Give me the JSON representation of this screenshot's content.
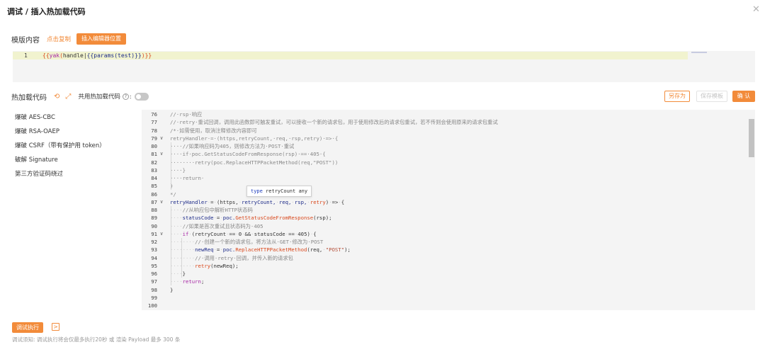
{
  "window": {
    "title": "调试 / 插入热加载代码",
    "close_icon": "close-icon"
  },
  "template_section": {
    "label": "模版内容",
    "copy_link": "点击复制",
    "insert_button": "插入编辑器位置",
    "line_number": "1",
    "code": {
      "open": "{{",
      "fn": "yak",
      "paren_open": "(",
      "arg": "handle",
      "pipe": "|",
      "inner_open": "{{",
      "inner_fn": "params",
      "inner_arg_open": "(",
      "inner_arg": "test",
      "inner_close": ")}}",
      "close": ")}}"
    }
  },
  "hotload_section": {
    "label": "热加载代码",
    "refresh_icon": "refresh-icon",
    "expand_icon": "expand-icon",
    "shared_label": "共用热加载代码",
    "help_icon": "?",
    "shared_enabled": false,
    "save_as": "另存为",
    "save_template": "保存模板",
    "confirm": "确 认"
  },
  "sidebar": {
    "items": [
      "爆破 AES-CBC",
      "爆破 RSA-OAEP",
      "爆破 CSRF（带有保护用 token）",
      "破解 Signature",
      "第三方验证码绕过"
    ]
  },
  "code_editor": {
    "tooltip": {
      "kw": "type",
      "name": "retryCount",
      "type": "any"
    },
    "lines": [
      {
        "n": "76",
        "fold": "",
        "segs": [
          [
            "c-com",
            "//·rsp·响应"
          ]
        ]
      },
      {
        "n": "77",
        "fold": "",
        "segs": [
          [
            "c-com",
            "//·retry·重试回调，调用此函数即可触发重试，可以接收一个新的请求包，用于使用修改后的请求包重试，若不传则会使用原来的请求包重试"
          ]
        ]
      },
      {
        "n": "78",
        "fold": "",
        "segs": [
          [
            "c-com",
            "/*·如需使用，取消注释修改内容即可"
          ]
        ]
      },
      {
        "n": "79",
        "fold": "∨",
        "segs": [
          [
            "c-com",
            "retryHandler·=·(https,retryCount,·req,·rsp,retry)·=>·{"
          ]
        ]
      },
      {
        "n": "80",
        "fold": "",
        "segs": [
          [
            "c-com",
            "····//如果响应码为405，则修改方法为·POST·重试"
          ]
        ]
      },
      {
        "n": "81",
        "fold": "∨",
        "segs": [
          [
            "c-com",
            "····if·poc.GetStatusCodeFromResponse(rsp)·==·405·{"
          ]
        ]
      },
      {
        "n": "82",
        "fold": "",
        "segs": [
          [
            "c-com",
            "········retry(poc.ReplaceHTTPPacketMethod(req,\"POST\"))"
          ]
        ]
      },
      {
        "n": "83",
        "fold": "",
        "segs": [
          [
            "c-com",
            "····}"
          ]
        ]
      },
      {
        "n": "84",
        "fold": "",
        "segs": [
          [
            "c-com",
            "····return·"
          ]
        ]
      },
      {
        "n": "85",
        "fold": "",
        "segs": [
          [
            "c-com",
            "}"
          ]
        ]
      },
      {
        "n": "86",
        "fold": "",
        "segs": [
          [
            "c-com",
            "*/"
          ]
        ]
      },
      {
        "n": "87",
        "fold": "∨",
        "segs": [
          [
            "c-var",
            "retryHandler"
          ],
          [
            "c-ws",
            "·"
          ],
          [
            "c-pl",
            "="
          ],
          [
            "c-ws",
            "·"
          ],
          [
            "c-pl",
            "(https,"
          ],
          [
            "c-ws",
            "·"
          ],
          [
            "c-var",
            "retryCount,"
          ],
          [
            "c-ws",
            "·"
          ],
          [
            "c-var",
            "req,"
          ],
          [
            "c-ws",
            "·"
          ],
          [
            "c-var",
            "rsp,"
          ],
          [
            "c-ws",
            "·"
          ],
          [
            "c-fn",
            "retry"
          ],
          [
            "c-pl",
            ")"
          ],
          [
            "c-ws",
            "·"
          ],
          [
            "c-pl",
            "=>"
          ],
          [
            "c-ws",
            "·"
          ],
          [
            "c-pl",
            "{"
          ]
        ]
      },
      {
        "n": "88",
        "fold": "",
        "segs": [
          [
            "c-ws",
            "····"
          ],
          [
            "c-com",
            "//从响应包中解析HTTP状态码"
          ]
        ]
      },
      {
        "n": "89",
        "fold": "",
        "segs": [
          [
            "c-ws",
            "····"
          ],
          [
            "c-var",
            "statusCode"
          ],
          [
            "c-ws",
            "·"
          ],
          [
            "c-pl",
            "="
          ],
          [
            "c-ws",
            "·"
          ],
          [
            "c-var",
            "poc."
          ],
          [
            "c-fn",
            "GetStatusCodeFromResponse"
          ],
          [
            "c-pl",
            "(rsp);"
          ]
        ]
      },
      {
        "n": "90",
        "fold": "",
        "segs": [
          [
            "c-ws",
            "····"
          ],
          [
            "c-com",
            "//如果是首次重试且状态码为·405"
          ]
        ]
      },
      {
        "n": "91",
        "fold": "∨",
        "segs": [
          [
            "c-ws",
            "····"
          ],
          [
            "c-kw",
            "if"
          ],
          [
            "c-ws",
            "·"
          ],
          [
            "c-pl",
            "(retryCount"
          ],
          [
            "c-ws",
            "·"
          ],
          [
            "c-pl",
            "=="
          ],
          [
            "c-ws",
            "·"
          ],
          [
            "c-pl",
            "0"
          ],
          [
            "c-ws",
            "·"
          ],
          [
            "c-pl",
            "&&"
          ],
          [
            "c-ws",
            "·"
          ],
          [
            "c-pl",
            "statusCode"
          ],
          [
            "c-ws",
            "·"
          ],
          [
            "c-pl",
            "=="
          ],
          [
            "c-ws",
            "·"
          ],
          [
            "c-pl",
            "405)"
          ],
          [
            "c-ws",
            "·"
          ],
          [
            "c-pl",
            "{"
          ]
        ]
      },
      {
        "n": "92",
        "fold": "",
        "segs": [
          [
            "c-ws",
            "········"
          ],
          [
            "c-com",
            "//·创建一个新的请求包，将方法从·GET·修改为·POST"
          ]
        ]
      },
      {
        "n": "93",
        "fold": "",
        "segs": [
          [
            "c-ws",
            "········"
          ],
          [
            "c-var",
            "newReq"
          ],
          [
            "c-ws",
            "·"
          ],
          [
            "c-pl",
            "="
          ],
          [
            "c-ws",
            "·"
          ],
          [
            "c-var",
            "poc."
          ],
          [
            "c-fn",
            "ReplaceHTTPPacketMethod"
          ],
          [
            "c-pl",
            "(req,"
          ],
          [
            "c-ws",
            "·"
          ],
          [
            "c-str",
            "\"POST\""
          ],
          [
            "c-pl",
            ");"
          ]
        ]
      },
      {
        "n": "94",
        "fold": "",
        "segs": [
          [
            "c-ws",
            "········"
          ],
          [
            "c-com",
            "//·调用·retry·回调，并传入新的请求包"
          ]
        ]
      },
      {
        "n": "95",
        "fold": "",
        "segs": [
          [
            "c-ws",
            "········"
          ],
          [
            "c-fn",
            "retry"
          ],
          [
            "c-pl",
            "(newReq);"
          ]
        ]
      },
      {
        "n": "96",
        "fold": "",
        "segs": [
          [
            "c-ws",
            "····"
          ],
          [
            "c-pl",
            "}"
          ]
        ]
      },
      {
        "n": "97",
        "fold": "",
        "segs": [
          [
            "c-ws",
            "····"
          ],
          [
            "c-kw",
            "return"
          ],
          [
            "c-pl",
            ";"
          ]
        ]
      },
      {
        "n": "98",
        "fold": "",
        "segs": [
          [
            "c-pl",
            "}"
          ]
        ]
      },
      {
        "n": "99",
        "fold": "",
        "segs": []
      },
      {
        "n": "100",
        "fold": "",
        "segs": []
      }
    ]
  },
  "footer": {
    "run_button": "调试执行",
    "log_icon": "terminal-icon",
    "hint": "调试须知: 调试执行将会仅最多执行20秒 或 渲染 Payload 最多 300 条"
  }
}
